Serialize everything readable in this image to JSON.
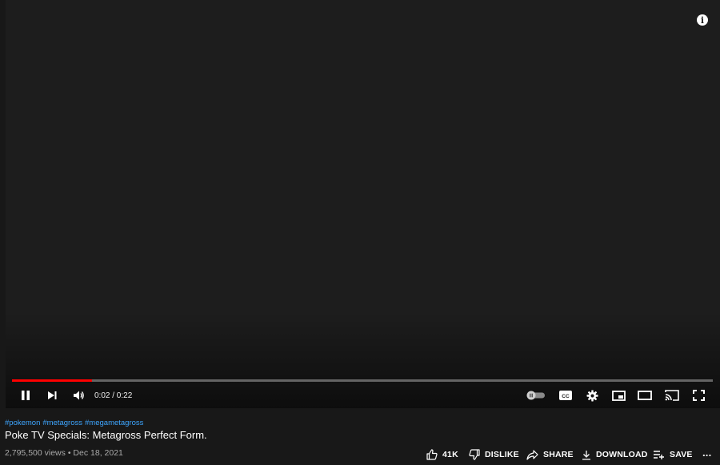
{
  "player": {
    "time_display": "0:02 / 0:22",
    "progress_fraction": 0.114,
    "progress_color": "#ff0000",
    "info_icon": "i"
  },
  "controls_icons": [
    "pause-icon",
    "next-icon",
    "volume-icon",
    "autoplay-toggle-icon",
    "captions-icon",
    "settings-icon",
    "miniplayer-icon",
    "theater-mode-icon",
    "cast-icon",
    "fullscreen-icon"
  ],
  "video": {
    "hashtags": [
      "#pokemon",
      "#metagross",
      "#megametagross"
    ],
    "title": "Poke TV Specials: Metagross Perfect Form.",
    "views": "2,795,500 views",
    "separator": "•",
    "date": "Dec 18, 2021"
  },
  "actions": {
    "like": "41K",
    "dislike": "DISLIKE",
    "share": "SHARE",
    "download": "DOWNLOAD",
    "save": "SAVE",
    "more": "..."
  },
  "colors": {
    "background": "#181818",
    "link": "#3ea6ff"
  }
}
